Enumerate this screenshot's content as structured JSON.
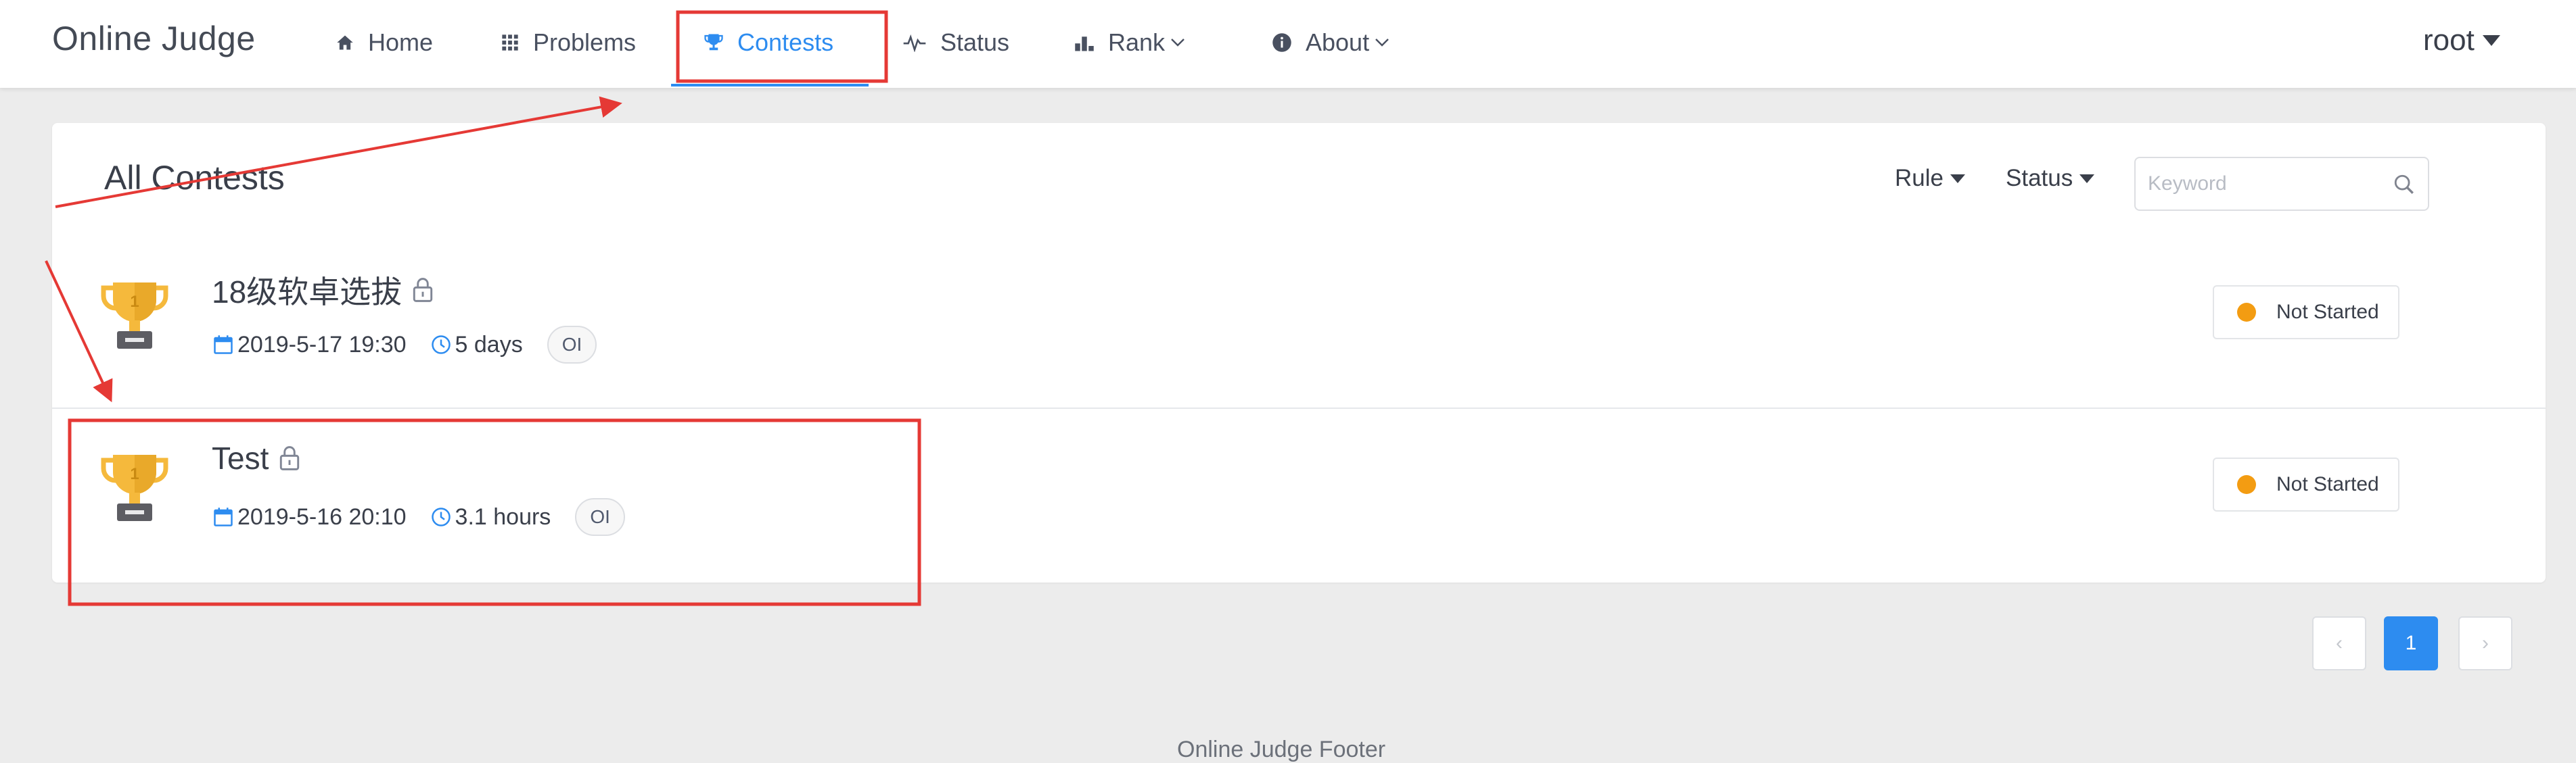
{
  "header": {
    "brand": "Online Judge",
    "nav": [
      {
        "label": "Home",
        "icon": "home-icon"
      },
      {
        "label": "Problems",
        "icon": "grid-icon"
      },
      {
        "label": "Contests",
        "icon": "trophy-icon",
        "active": true
      },
      {
        "label": "Status",
        "icon": "pulse-icon"
      },
      {
        "label": "Rank",
        "icon": "bar-chart-icon",
        "dropdown": true
      },
      {
        "label": "About",
        "icon": "info-icon",
        "dropdown": true
      }
    ],
    "user": "root"
  },
  "contests_card": {
    "title": "All Contests",
    "filters": {
      "rule": "Rule",
      "status": "Status"
    },
    "search": {
      "placeholder": "Keyword",
      "value": ""
    },
    "rows": [
      {
        "title": "18级软卓选拔",
        "start": "2019-5-17 19:30",
        "duration": "5 days",
        "tag": "OI",
        "status": "Not Started",
        "locked": true
      },
      {
        "title": "Test",
        "start": "2019-5-16 20:10",
        "duration": "3.1 hours",
        "tag": "OI",
        "status": "Not Started",
        "locked": true
      }
    ]
  },
  "pagination": {
    "prev": "‹",
    "current": "1",
    "next": "›"
  },
  "footer": {
    "text": "Online Judge Footer"
  },
  "colors": {
    "accent": "#2d8cf0",
    "status_not_started": "#f39c12",
    "annotation": "#e53935",
    "trophy_gold": "#f5b93c"
  }
}
